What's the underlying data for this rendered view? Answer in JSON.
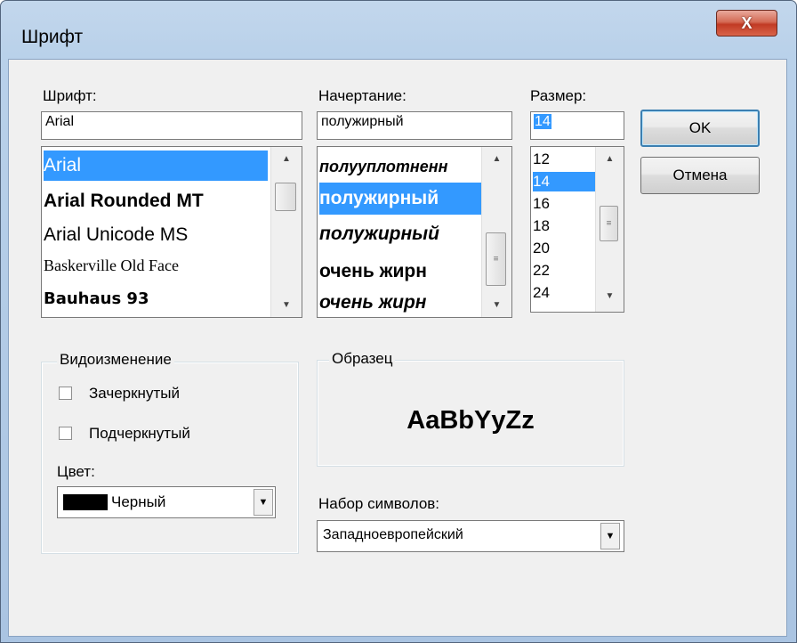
{
  "window": {
    "title": "Шрифт",
    "close_glyph": "X"
  },
  "font": {
    "label": "Шрифт:",
    "value": "Arial",
    "items": [
      "Arial",
      "Arial Rounded MT",
      "Arial Unicode MS",
      "Baskerville Old Face",
      "Bauhaus 93"
    ],
    "selected": "Arial"
  },
  "style": {
    "label": "Начертание:",
    "value": "полужирный",
    "items": [
      "полууплотненн",
      "полужирный",
      "полужирный",
      "очень жирн",
      "очень жирн"
    ],
    "selected": "полужирный"
  },
  "size": {
    "label": "Размер:",
    "value": "14",
    "items": [
      "12",
      "14",
      "16",
      "18",
      "20",
      "22",
      "24"
    ],
    "selected": "14"
  },
  "buttons": {
    "ok": "OK",
    "cancel": "Отмена"
  },
  "effects": {
    "title": "Видоизменение",
    "strikeout": {
      "label": "Зачеркнутый",
      "checked": false
    },
    "underline": {
      "label": "Подчеркнутый",
      "checked": false
    },
    "color_label": "Цвет:",
    "color_value": "Черный",
    "color_swatch": "#000000"
  },
  "sample": {
    "title": "Образец",
    "text": "AaBbYyZz"
  },
  "charset": {
    "label": "Набор символов:",
    "value": "Западноевропейский"
  },
  "colors": {
    "selection": "#3399ff",
    "dialog_bg": "#f0f0f0",
    "close_button": "#c7402a"
  }
}
